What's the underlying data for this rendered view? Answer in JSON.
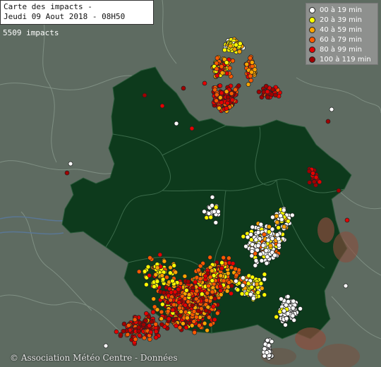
{
  "title": {
    "line1": "Carte des impacts -",
    "line2": "Jeudi 09 Aout 2018 - 08H50"
  },
  "impact_count": "5509 impacts",
  "legend": [
    {
      "label": "00 à 19 min",
      "color": "#ffffff"
    },
    {
      "label": "20 à 39 min",
      "color": "#ffff00"
    },
    {
      "label": "40 à 59 min",
      "color": "#ffa500"
    },
    {
      "label": "60 à 79 min",
      "color": "#ff5a00"
    },
    {
      "label": "80 à 99 min",
      "color": "#e60000"
    },
    {
      "label": "100 à 119 min",
      "color": "#a00000"
    }
  ],
  "copyright": "© Association Météo Centre - Données",
  "colors": {
    "background": "#5e6b61",
    "region_fill": "#0d3a1c",
    "border_line": "#7f8f83",
    "river": "#5a7795",
    "terrain": "#8b4d3c"
  }
}
